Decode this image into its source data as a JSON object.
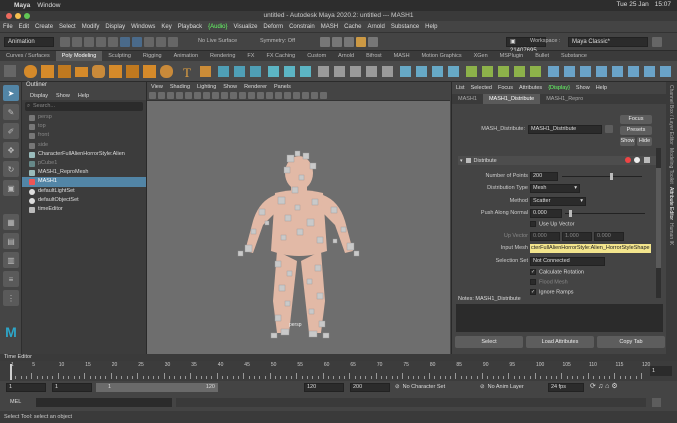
{
  "mac": {
    "apple": "",
    "app": "Maya",
    "menu": [
      "Window"
    ],
    "day": "Tue 25 Jan",
    "time": "15:07"
  },
  "title": "untitled - Autodesk Maya 2020.2: untitled  ---  MASH1",
  "menu": [
    "File",
    "Edit",
    "Create",
    "Select",
    "Modify",
    "Display",
    "Windows",
    "Key",
    "Playback",
    "Audio",
    "Visualize",
    "Deform",
    "Constrain",
    "MASH",
    "Cache",
    "Arnold",
    "Substance",
    "Help"
  ],
  "menu_highlight": "Audio",
  "status": {
    "menuset": "Animation",
    "live": "No Live Surface",
    "symmetry": "Symmetry: Off",
    "sel_count": "21407695",
    "workspace_label": "Workspace :",
    "workspace": "Maya Classic*"
  },
  "shelf_tabs": [
    "Curves / Surfaces",
    "Poly Modeling",
    "Sculpting",
    "Rigging",
    "Animation",
    "Rendering",
    "FX",
    "FX Caching",
    "Custom",
    "Arnold",
    "Bifrost",
    "MASH",
    "Motion Graphics",
    "XGen",
    "MSPlugin",
    "Bullet",
    "Substance"
  ],
  "shelf_active": "Poly Modeling",
  "outliner": {
    "title": "Outliner",
    "menu": [
      "Display",
      "Show",
      "Help"
    ],
    "search": "Search...",
    "items": [
      {
        "label": "persp",
        "dim": true
      },
      {
        "label": "top",
        "dim": true
      },
      {
        "label": "front",
        "dim": true
      },
      {
        "label": "side",
        "dim": true
      },
      {
        "label": "CharacterFullAlienHorrorStyle:Alien",
        "dim": false
      },
      {
        "label": "pCube1",
        "dim": true
      },
      {
        "label": "MASH1_ReproMesh",
        "dim": false
      },
      {
        "label": "MASH1",
        "dim": false,
        "selected": true
      },
      {
        "label": "defaultLightSet",
        "dim": false
      },
      {
        "label": "defaultObjectSet",
        "dim": false
      },
      {
        "label": "timeEditor",
        "dim": false
      }
    ]
  },
  "viewport": {
    "menu": [
      "View",
      "Shading",
      "Lighting",
      "Show",
      "Renderer",
      "Panels"
    ],
    "camera": "persp"
  },
  "attr": {
    "menu": [
      "List",
      "Selected",
      "Focus",
      "Attributes",
      "Display",
      "Show",
      "Help"
    ],
    "tabs": [
      "MASH1",
      "MASH1_Distribute",
      "MASH1_Repro"
    ],
    "node_label": "MASH_Distribute:",
    "node_name": "MASH1_Distribute",
    "focus": "Focus",
    "presets": "Presets",
    "show": "Show",
    "hide": "Hide",
    "section": "Distribute",
    "points_label": "Number of Points",
    "points": "200",
    "dist_type_label": "Distribution Type",
    "dist_type": "Mesh",
    "method_label": "Method",
    "method": "Scatter",
    "push_label": "Push Along Normal",
    "push": "0.000",
    "use_up": "Use Up Vector",
    "up_label": "Up Vector",
    "up": [
      "0.000",
      "1.000",
      "0.000"
    ],
    "input_label": "Input Mesh",
    "input": "cterFullAlienHorrorStyle:Alien_HorrorStyleShape",
    "selset_label": "Selection Set",
    "selset": "Not Connected",
    "calc_rot": "Calculate Rotation",
    "flood": "Flood Mesh",
    "ignore": "Ignore Ramps",
    "notes": "Notes:  MASH1_Distribute",
    "buttons": [
      "Select",
      "Load Attributes",
      "Copy Tab"
    ]
  },
  "side_tabs": [
    "Channel Box / Layer Editor",
    "Modeling Toolkit",
    "Attribute Editor",
    "Human IK"
  ],
  "time_editor": "Time Editor",
  "ticks": [
    "1",
    "5",
    "10",
    "15",
    "20",
    "25",
    "30",
    "35",
    "40",
    "45",
    "50",
    "55",
    "60",
    "65",
    "70",
    "75",
    "80",
    "85",
    "90",
    "95",
    "100",
    "105",
    "110",
    "115",
    "120"
  ],
  "current_frame": "1",
  "range": {
    "start": "1",
    "start2": "1",
    "slider_start": "1",
    "slider_end": "120",
    "end": "120",
    "end2": "200",
    "char": "No Character Set",
    "anim": "No Anim Layer",
    "fps": "24 fps"
  },
  "mel": "MEL",
  "help": "Select Tool: select an object"
}
